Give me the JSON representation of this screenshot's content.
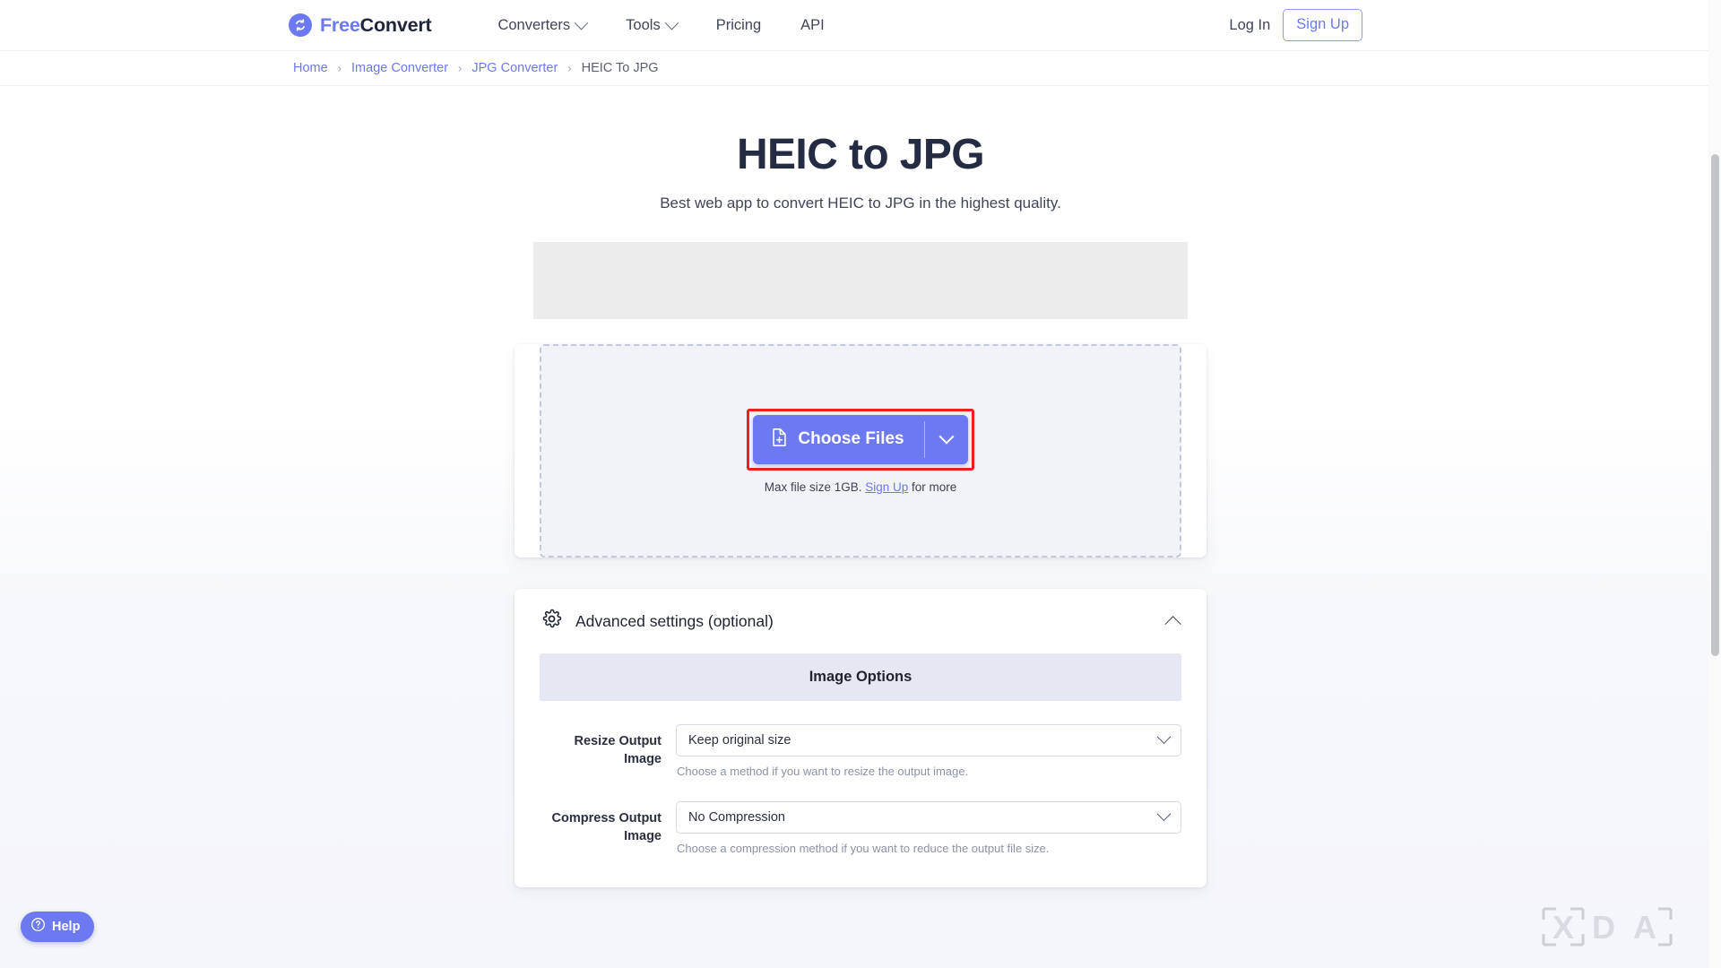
{
  "header": {
    "brand": {
      "first": "Free",
      "second": "Convert",
      "icon": "refresh-circle-icon"
    },
    "nav": [
      {
        "label": "Converters",
        "has_caret": true
      },
      {
        "label": "Tools",
        "has_caret": true
      },
      {
        "label": "Pricing",
        "has_caret": false
      },
      {
        "label": "API",
        "has_caret": false
      }
    ],
    "login_label": "Log In",
    "signup_label": "Sign Up"
  },
  "breadcrumb": {
    "items": [
      "Home",
      "Image Converter",
      "JPG Converter"
    ],
    "current": "HEIC To JPG",
    "separator": "›"
  },
  "hero": {
    "title": "HEIC to JPG",
    "subtitle": "Best web app to convert HEIC to JPG in the highest quality."
  },
  "upload": {
    "choose_label": "Choose Files",
    "choose_icon": "file-plus-icon",
    "caret_icon": "chevron-down-icon",
    "maxsize_prefix": "Max file size 1GB. ",
    "maxsize_link": "Sign Up",
    "maxsize_suffix": " for more",
    "highlight_color": "#f21d1d"
  },
  "advanced": {
    "title": "Advanced settings (optional)",
    "icon": "gear-icon",
    "collapse_icon": "chevron-up-icon",
    "section_title": "Image Options",
    "fields": [
      {
        "label": "Resize Output Image",
        "value": "Keep original size",
        "hint": "Choose a method if you want to resize the output image."
      },
      {
        "label": "Compress Output Image",
        "value": "No Compression",
        "hint": "Choose a compression method if you want to reduce the output file size."
      }
    ]
  },
  "help": {
    "label": "Help",
    "icon": "question-circle-icon"
  },
  "watermark": {
    "text": "XDA"
  },
  "colors": {
    "accent": "#6c79f0",
    "title": "#252b42",
    "link": "#6c79f0",
    "section_bg": "#e5e8f2",
    "highlight": "#f21d1d"
  }
}
